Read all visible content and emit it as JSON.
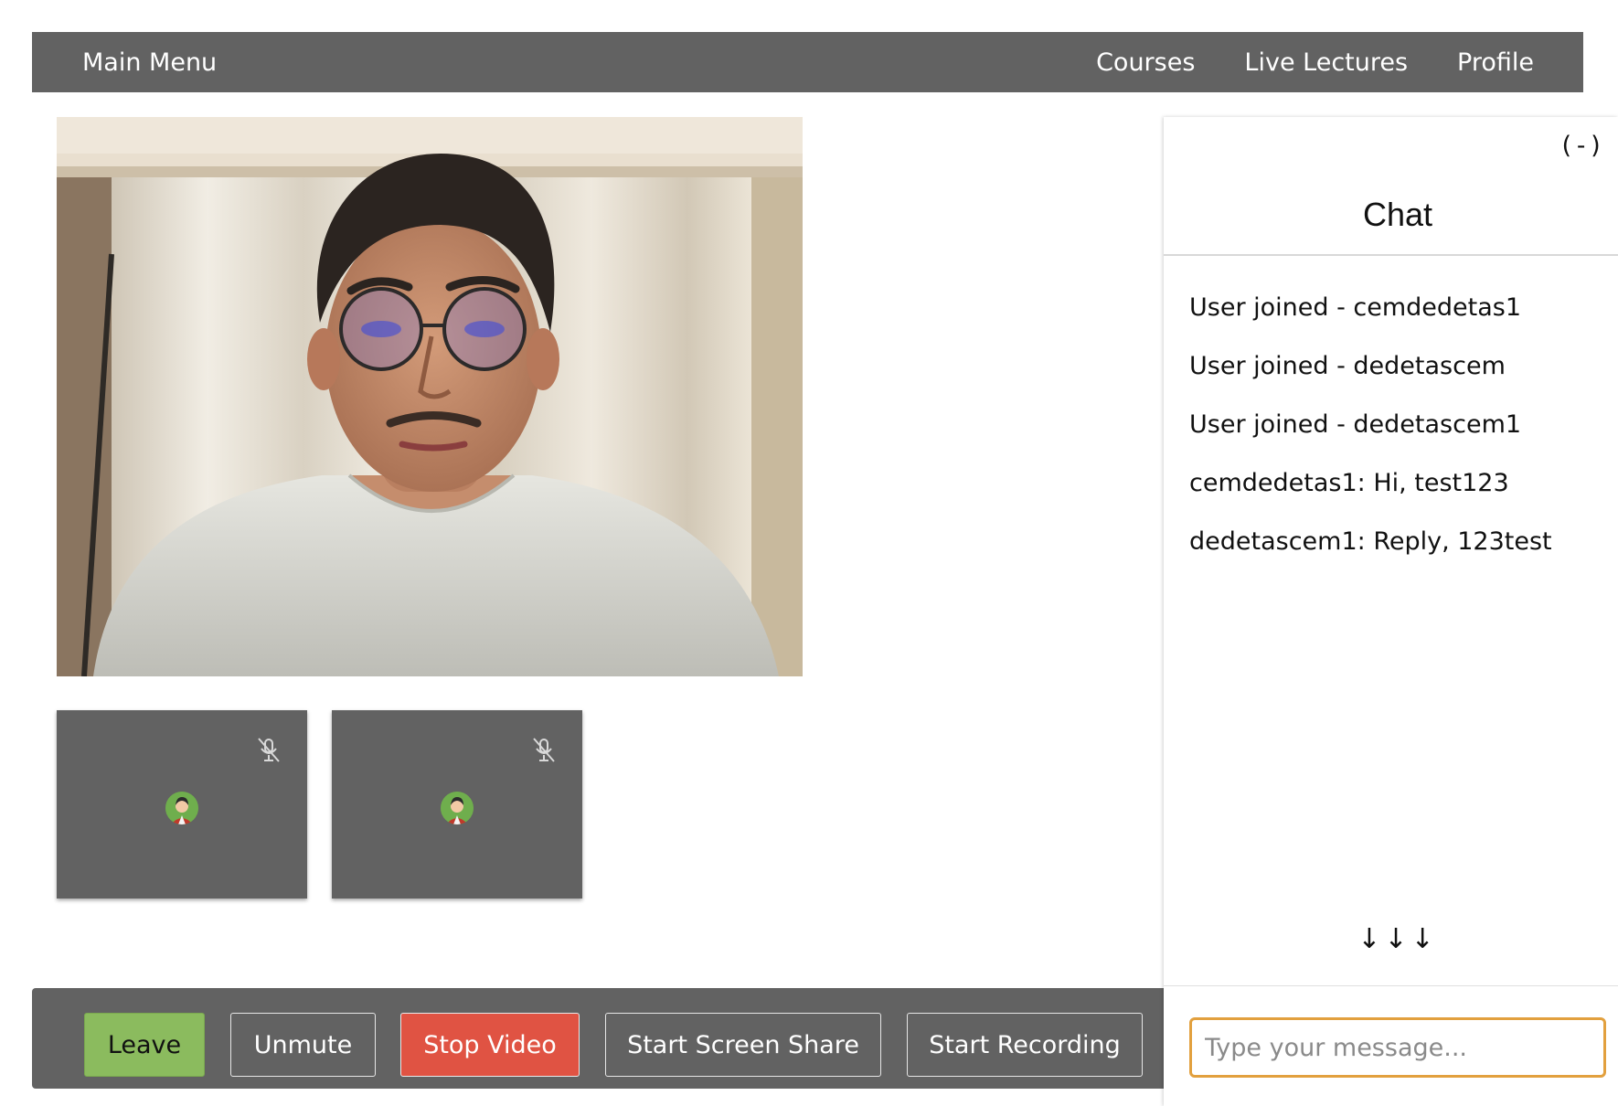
{
  "navbar": {
    "brand": "Main Menu",
    "links": [
      "Courses",
      "Live Lectures",
      "Profile"
    ]
  },
  "main_video": {
    "label": "camera-feed-person",
    "colors": {
      "wall": "#c9b89d",
      "curtain": "#e8e2d6",
      "shirt": "#dcdcd6",
      "skin": "#c58d6d",
      "hair": "#2b2420"
    }
  },
  "participants": [
    {
      "muted_icon": "mic-off-icon",
      "avatar": "user-avatar"
    },
    {
      "muted_icon": "mic-off-icon",
      "avatar": "user-avatar"
    }
  ],
  "controls": {
    "leave": "Leave",
    "unmute": "Unmute",
    "stop_video": "Stop Video",
    "screen_share": "Start Screen Share",
    "recording": "Start Recording"
  },
  "chat": {
    "minimize": "(-)",
    "title": "Chat",
    "messages": [
      "User joined - cemdedetas1",
      "User joined - dedetascem",
      "User joined - dedetascem1",
      "cemdedetas1: Hi, test123",
      "dedetascem1: Reply, 123test"
    ],
    "scroll_down": "↓↓↓",
    "input_value": "",
    "input_placeholder": "Type your message..."
  },
  "colors": {
    "bar": "#626262",
    "leave": "#8bbb5e",
    "stop_video": "#e05343",
    "input_focus": "#e2a03e"
  }
}
